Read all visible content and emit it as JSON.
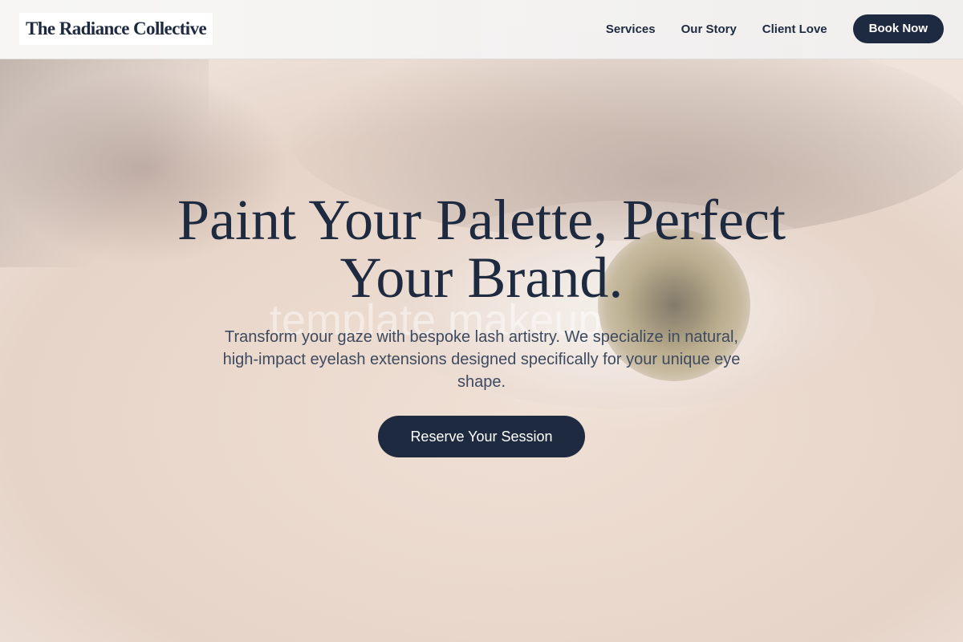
{
  "brand": {
    "name": "The Radiance Collective"
  },
  "nav": {
    "links": [
      "Services",
      "Our Story",
      "Client Love"
    ],
    "cta_label": "Book Now"
  },
  "hero": {
    "title": "Paint Your Palette, Perfect Your Brand.",
    "subtitle": "Transform your gaze with bespoke lash artistry. We specialize in natural, high-impact eyelash extensions designed specifically for your unique eye shape.",
    "cta_label": "Reserve Your Session",
    "watermark": "template makeup",
    "background_icon": "eye-closeup-photo"
  },
  "colors": {
    "primary": "#1e2a3f",
    "nav_bg": "#f3f2f1",
    "hero_bg": "#ead8cc",
    "button_text": "#ffffff"
  }
}
